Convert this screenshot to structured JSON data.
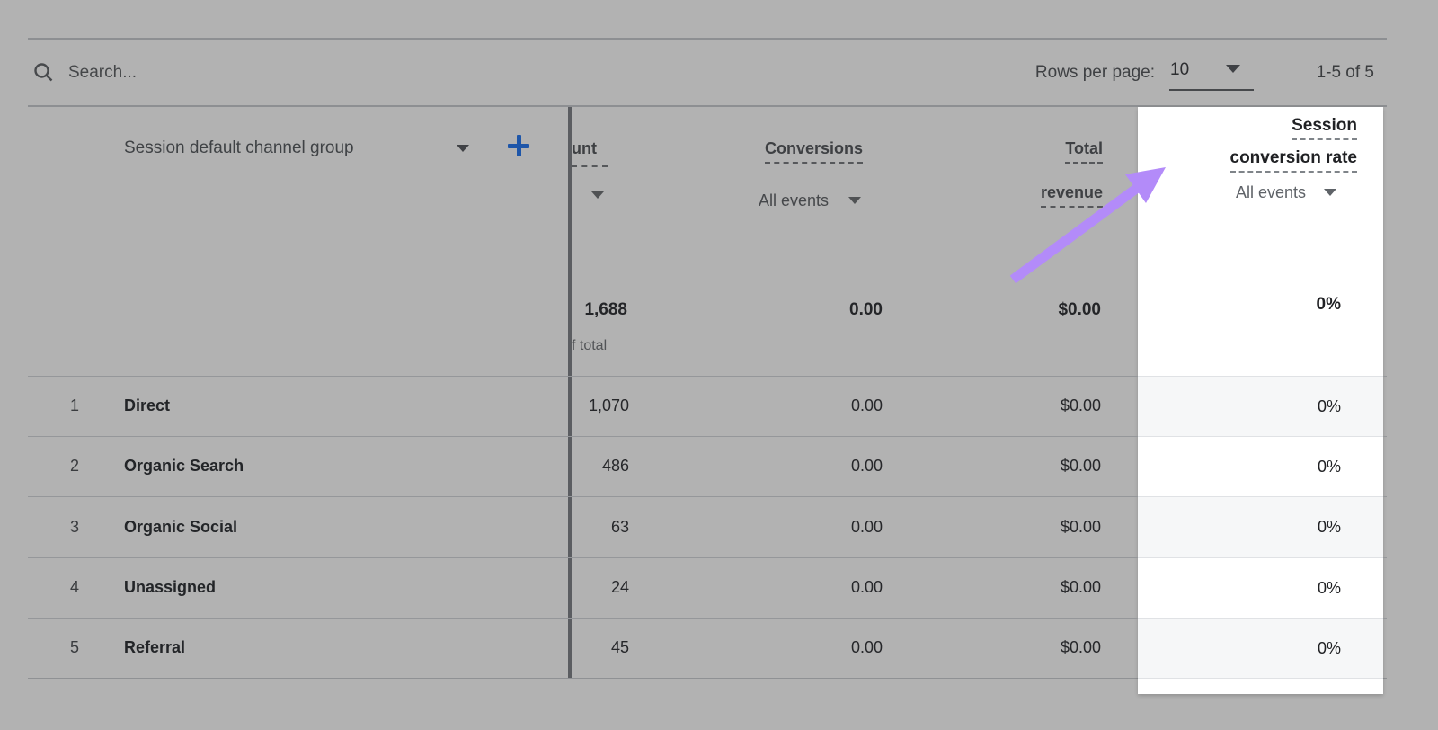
{
  "toolbar": {
    "search_placeholder": "Search...",
    "rows_per_page_label": "Rows per page:",
    "rows_per_page_value": "10",
    "pagination_range": "1-5 of 5"
  },
  "table": {
    "dimension_header": "Session default channel group",
    "columns": {
      "clipped_metric": {
        "visible_label": "unt"
      },
      "conversions": {
        "label": "Conversions",
        "sublabel": "All events"
      },
      "total_revenue": {
        "label_line1": "Total",
        "label_line2": "revenue"
      },
      "session_conversion_rate": {
        "label_line1": "Session",
        "label_line2": "conversion rate",
        "sublabel": "All events"
      }
    },
    "totals": {
      "count": "1,688",
      "count_caption_visible": "f total",
      "conversions": "0.00",
      "revenue": "$0.00",
      "rate": "0%"
    },
    "rows": [
      {
        "num": "1",
        "channel": "Direct",
        "count": "1,070",
        "conversions": "0.00",
        "revenue": "$0.00",
        "rate": "0%"
      },
      {
        "num": "2",
        "channel": "Organic Search",
        "count": "486",
        "conversions": "0.00",
        "revenue": "$0.00",
        "rate": "0%"
      },
      {
        "num": "3",
        "channel": "Organic Social",
        "count": "63",
        "conversions": "0.00",
        "revenue": "$0.00",
        "rate": "0%"
      },
      {
        "num": "4",
        "channel": "Unassigned",
        "count": "24",
        "conversions": "0.00",
        "revenue": "$0.00",
        "rate": "0%"
      },
      {
        "num": "5",
        "channel": "Referral",
        "count": "45",
        "conversions": "0.00",
        "revenue": "$0.00",
        "rate": "0%"
      }
    ]
  },
  "annotation": {
    "shape": "arrow",
    "color": "#b38bf9",
    "points_to": "Session conversion rate column header"
  },
  "icons": {
    "search": "magnifier",
    "dropdown": "triangle-down",
    "add_metric": "plus"
  },
  "colors": {
    "dimmed_background": "#b2b2b2",
    "highlight_column_bg": "#ffffff",
    "highlight_stripe_bg": "#f6f7f8",
    "plus_blue": "#1e56a9",
    "arrow_purple": "#b38bf9"
  }
}
